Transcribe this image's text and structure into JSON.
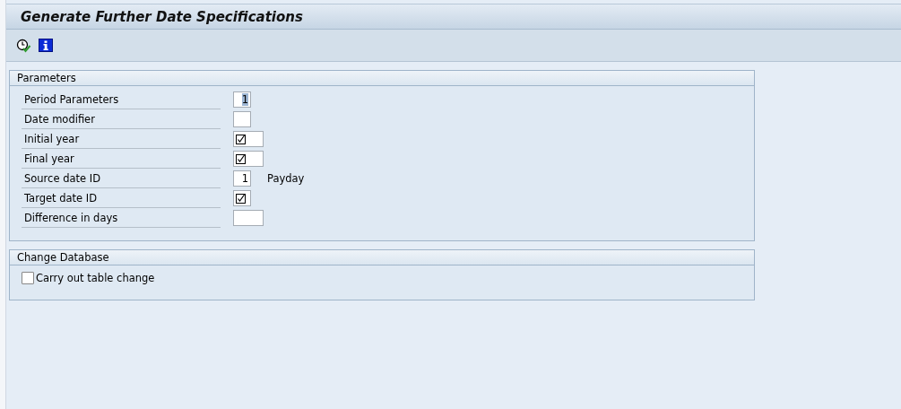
{
  "window": {
    "title": "Generate Further Date Specifications"
  },
  "toolbar": [
    {
      "kind": "execute"
    },
    {
      "kind": "info"
    }
  ],
  "groups": [
    {
      "title": "Parameters",
      "fields": [
        {
          "label": "Period Parameters",
          "kind": "short",
          "value": "1",
          "required": false,
          "text_selected": true
        },
        {
          "label": "Date modifier",
          "kind": "short",
          "required": false
        },
        {
          "label": "Initial year",
          "kind": "long",
          "required": true
        },
        {
          "label": "Final year",
          "kind": "long",
          "required": true
        },
        {
          "label": "Source date ID",
          "kind": "short",
          "value": "1",
          "required": false,
          "text_selected": false,
          "description": "Payday"
        },
        {
          "label": "Target date ID",
          "kind": "short",
          "required": true
        },
        {
          "label": "Difference in days",
          "kind": "long",
          "required": false
        }
      ]
    },
    {
      "title": "Change Database",
      "checkboxes": [
        {
          "label": "Carry out table change",
          "checked": false
        }
      ]
    }
  ]
}
